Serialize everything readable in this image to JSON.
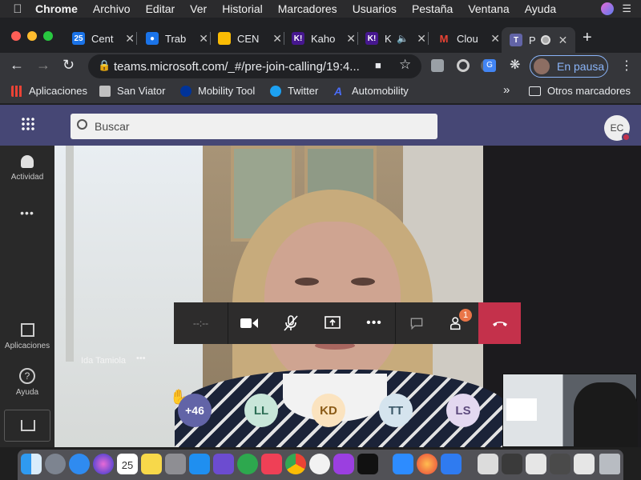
{
  "menubar": {
    "items": [
      "Chrome",
      "Archivo",
      "Editar",
      "Ver",
      "Historial",
      "Marcadores",
      "Usuarios",
      "Pestaña",
      "Ventana",
      "Ayuda"
    ]
  },
  "tabs": [
    {
      "label": "Cent",
      "fav_text": "25",
      "fav_color": "#1a73e8"
    },
    {
      "label": "Trab",
      "fav_text": "",
      "fav_color": "#1a73e8"
    },
    {
      "label": "CEN",
      "fav_text": "",
      "fav_color": "#fbbc04"
    },
    {
      "label": "Kaho",
      "fav_text": "K!",
      "fav_color": "#46178f"
    },
    {
      "label": "K",
      "fav_text": "K!",
      "fav_color": "#46178f"
    },
    {
      "label": "Clou",
      "fav_text": "M",
      "fav_color": "#ea4335"
    },
    {
      "label": "P",
      "fav_text": "T",
      "fav_color": "#6264a7"
    }
  ],
  "toolbar": {
    "url": "teams.microsoft.com/_#/pre-join-calling/19:4...",
    "profile_label": "En pausa"
  },
  "bookmarks": {
    "items": [
      "Aplicaciones",
      "San Viator",
      "Mobility Tool",
      "Twitter",
      "Automobility"
    ],
    "more": "»",
    "other": "Otros marcadores"
  },
  "teams": {
    "search_placeholder": "Buscar",
    "avatar_initials": "EC",
    "rail": {
      "activity": "Actividad",
      "more": "•••",
      "apps": "Aplicaciones",
      "help": "Ayuda"
    }
  },
  "call": {
    "timer": "--:--",
    "people_badge": "1",
    "speaker_name": "Ida Tamiola",
    "overflow_count": "+46",
    "participants": [
      {
        "initials": "LL",
        "bg": "#c8e6d9",
        "fg": "#2c6e55"
      },
      {
        "initials": "KD",
        "bg": "#fbe3bf",
        "fg": "#8a5a16"
      },
      {
        "initials": "TT",
        "bg": "#d5e4ee",
        "fg": "#3b5868"
      },
      {
        "initials": "LS",
        "bg": "#e3d8f0",
        "fg": "#5d4a7d"
      }
    ]
  },
  "colors": {
    "teams_header": "#464775",
    "hangup": "#c4314b",
    "overflow_bg": "#6264a7"
  }
}
